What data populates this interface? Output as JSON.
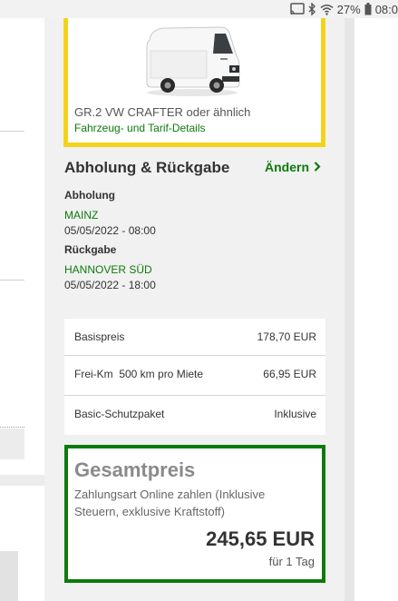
{
  "status_bar": {
    "battery": "27%",
    "time": "08:0"
  },
  "vehicle": {
    "name": "GR.2 VW CRAFTER oder ähnlich",
    "details_link": "Fahrzeug- und Tarif-Details",
    "image": "white-van"
  },
  "pickup_return": {
    "title": "Abholung & Rückgabe",
    "change_label": "Ändern",
    "pickup_label": "Abholung",
    "pickup_location": "MAINZ",
    "pickup_datetime": "05/05/2022 - 08:00",
    "return_label": "Rückgabe",
    "return_location": "HANNOVER SÜD",
    "return_datetime": "05/05/2022 - 18:00"
  },
  "price_rows": [
    {
      "label": "Basispreis",
      "value": "178,70 EUR"
    },
    {
      "label": "Frei-Km  500 km pro Miete",
      "value": "66,95 EUR"
    },
    {
      "label": "Basic-Schutzpaket",
      "value": "Inklusive"
    }
  ],
  "total": {
    "title": "Gesamtpreis",
    "description": "Zahlungsart Online zahlen (Inklusive Steuern, exklusive Kraftstoff)",
    "amount": "245,65 EUR",
    "per": "für 1 Tag"
  },
  "colors": {
    "accent_green": "#0d7a0d",
    "highlight_yellow": "#f3d31a"
  }
}
